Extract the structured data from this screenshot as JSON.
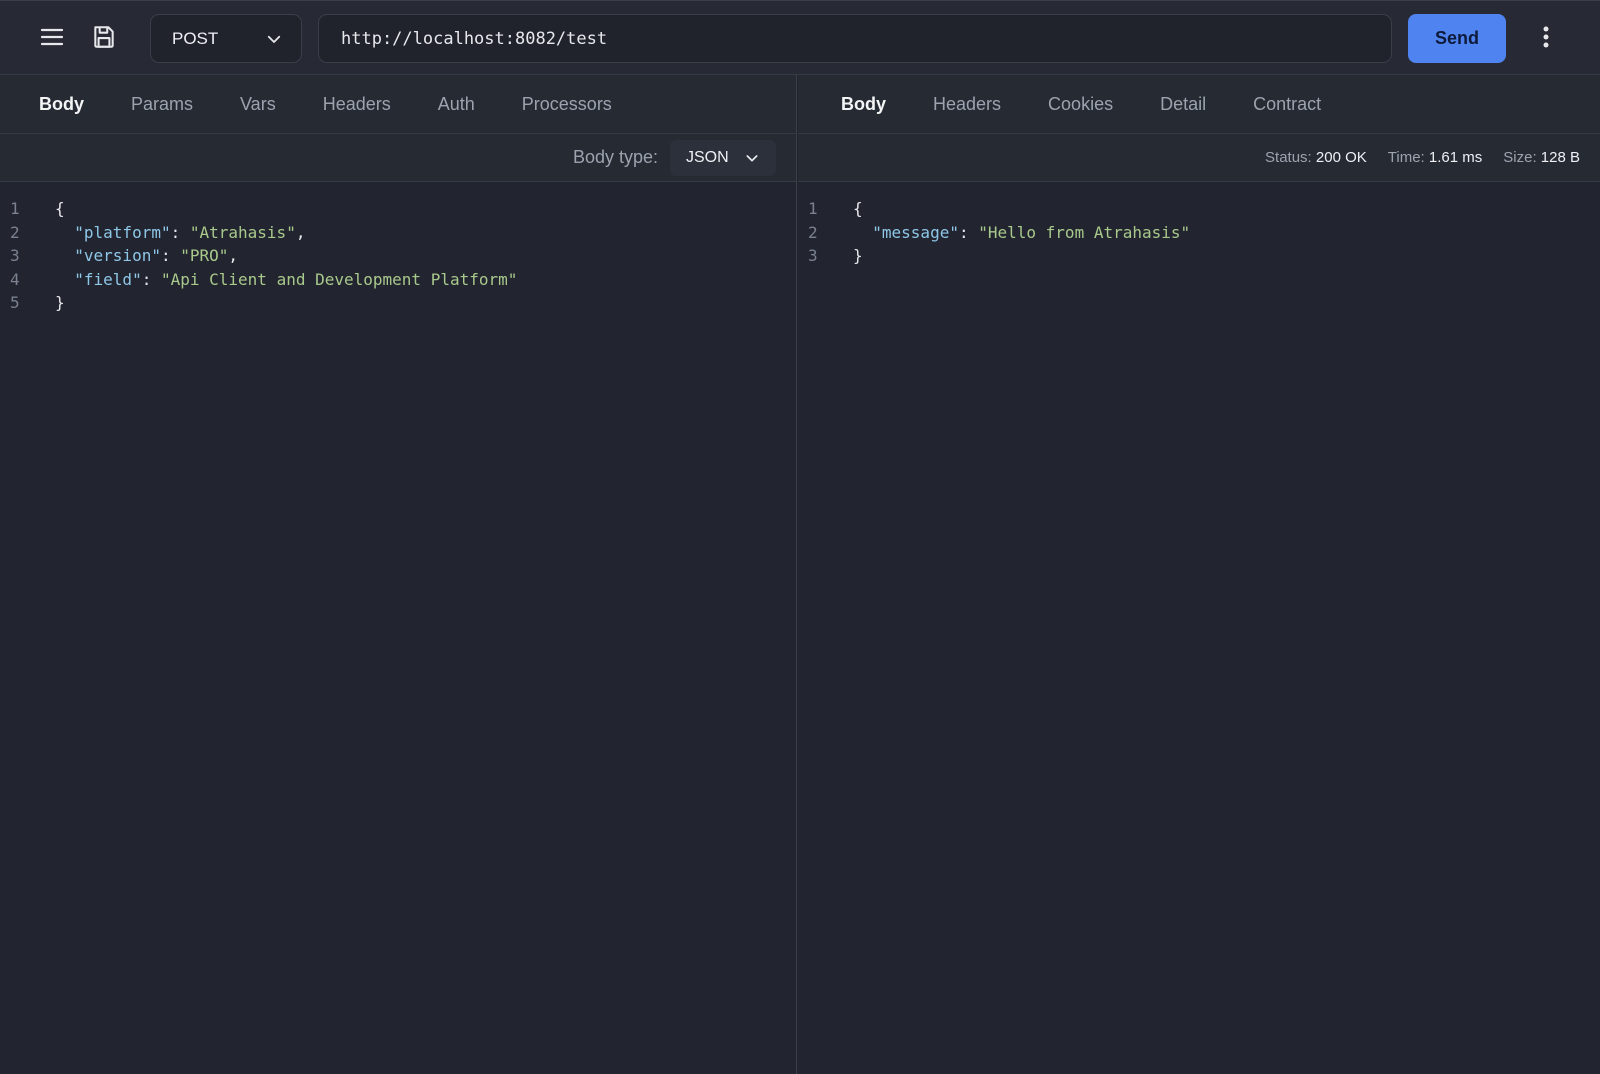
{
  "toolbar": {
    "menu_icon": "hamburger-menu-icon",
    "save_icon": "floppy-disk-icon",
    "method": "POST",
    "url": "http://localhost:8082/test",
    "send_label": "Send",
    "more_icon": "vertical-dots-icon"
  },
  "request": {
    "tabs": [
      "Body",
      "Params",
      "Vars",
      "Headers",
      "Auth",
      "Processors"
    ],
    "active_tab": "Body",
    "body_type_label": "Body type:",
    "body_type": "JSON",
    "lines": [
      {
        "n": "1",
        "parts": [
          {
            "t": "{",
            "c": "p"
          }
        ]
      },
      {
        "n": "2",
        "parts": [
          {
            "t": "  ",
            "c": "p"
          },
          {
            "t": "\"platform\"",
            "c": "k"
          },
          {
            "t": ": ",
            "c": "p"
          },
          {
            "t": "\"Atrahasis\"",
            "c": "s"
          },
          {
            "t": ",",
            "c": "p"
          }
        ]
      },
      {
        "n": "3",
        "parts": [
          {
            "t": "  ",
            "c": "p"
          },
          {
            "t": "\"version\"",
            "c": "k"
          },
          {
            "t": ": ",
            "c": "p"
          },
          {
            "t": "\"PRO\"",
            "c": "s"
          },
          {
            "t": ",",
            "c": "p"
          }
        ]
      },
      {
        "n": "4",
        "parts": [
          {
            "t": "  ",
            "c": "p"
          },
          {
            "t": "\"field\"",
            "c": "k"
          },
          {
            "t": ": ",
            "c": "p"
          },
          {
            "t": "\"Api Client and Development Platform\"",
            "c": "s"
          }
        ]
      },
      {
        "n": "5",
        "parts": [
          {
            "t": "}",
            "c": "p"
          }
        ]
      }
    ]
  },
  "response": {
    "tabs": [
      "Body",
      "Headers",
      "Cookies",
      "Detail",
      "Contract"
    ],
    "active_tab": "Body",
    "status_label": "Status:",
    "status_value": "200 OK",
    "time_label": "Time:",
    "time_value": "1.61 ms",
    "size_label": "Size:",
    "size_value": "128 B",
    "lines": [
      {
        "n": "1",
        "parts": [
          {
            "t": "{",
            "c": "p"
          }
        ]
      },
      {
        "n": "2",
        "parts": [
          {
            "t": "  ",
            "c": "p"
          },
          {
            "t": "\"message\"",
            "c": "k"
          },
          {
            "t": ": ",
            "c": "p"
          },
          {
            "t": "\"Hello from Atrahasis\"",
            "c": "s"
          }
        ]
      },
      {
        "n": "3",
        "parts": [
          {
            "t": "}",
            "c": "p"
          }
        ]
      }
    ]
  }
}
